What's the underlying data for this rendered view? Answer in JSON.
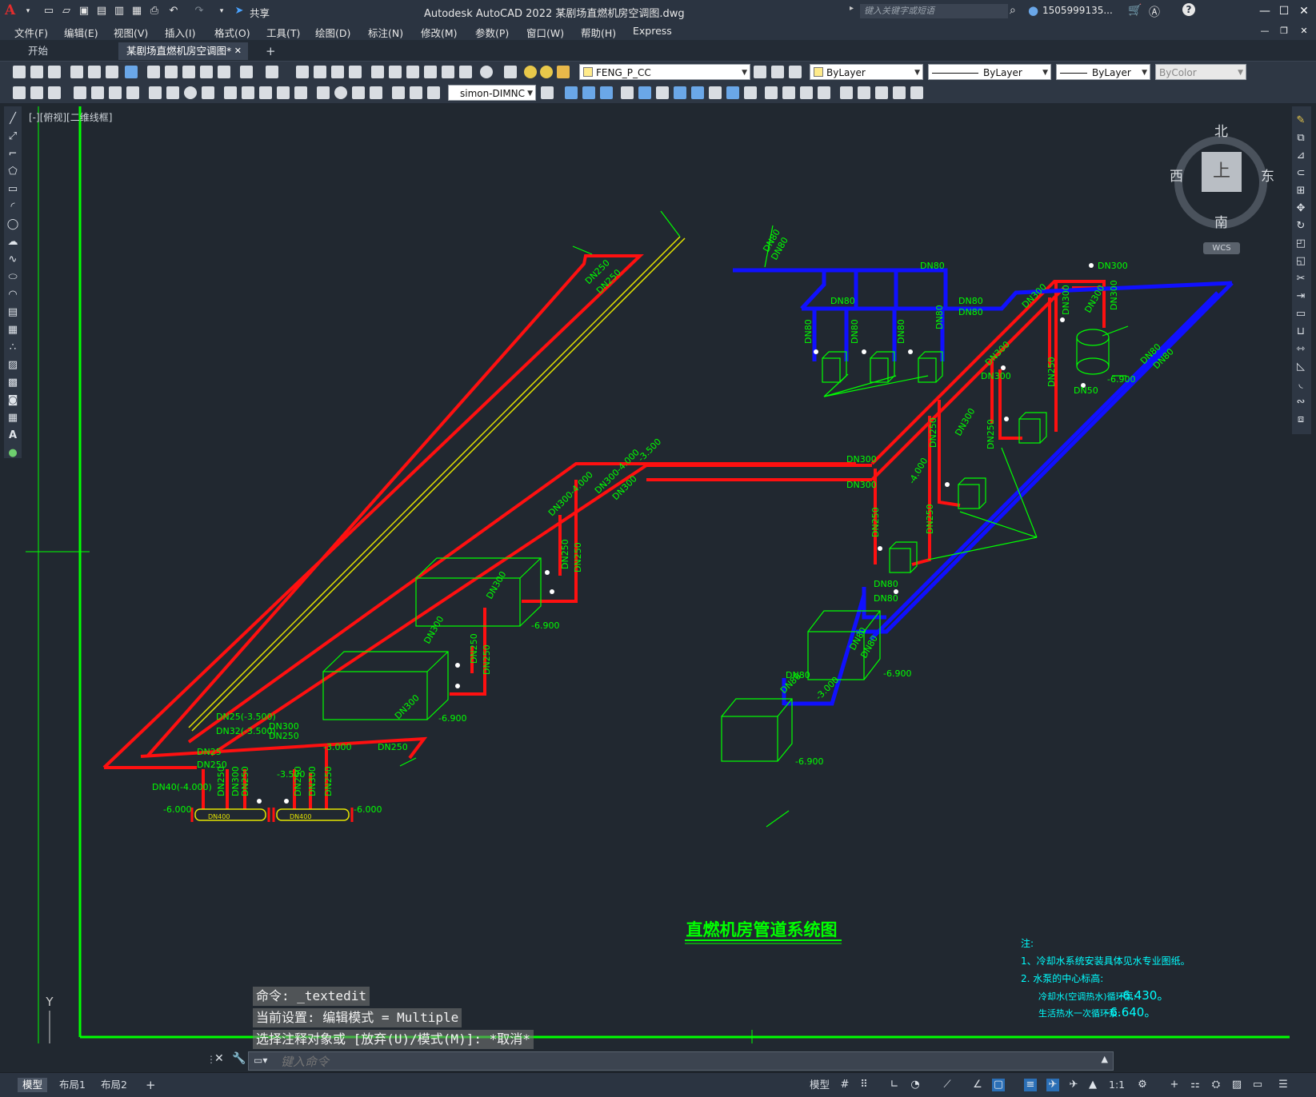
{
  "app": {
    "title": "Autodesk AutoCAD 2022    某剧场直燃机房空调图.dwg",
    "logo": "A",
    "share_label": "共享",
    "search_placeholder": "键入关键字或短语",
    "user": "1505999135...",
    "help": "?"
  },
  "menu": [
    "文件(F)",
    "编辑(E)",
    "视图(V)",
    "插入(I)",
    "格式(O)",
    "工具(T)",
    "绘图(D)",
    "标注(N)",
    "修改(M)",
    "参数(P)",
    "窗口(W)",
    "帮助(H)",
    "Express"
  ],
  "tabs": {
    "start": "开始",
    "drawing": "某剧场直燃机房空调图*",
    "add": "+"
  },
  "toolbar": {
    "layer": "FENG_P_CC",
    "color": "ByLayer",
    "linetype": "ByLayer",
    "lineweight": "ByLayer",
    "plotstyle": "ByColor",
    "dimstyle": "simon-DIMNC"
  },
  "viewport": {
    "label": "[-][俯视][二维线框]",
    "viewcube": {
      "top": "上",
      "north": "北",
      "south": "南",
      "east": "东",
      "west": "西",
      "wcs": "WCS"
    }
  },
  "drawing": {
    "title": "直燃机房管道系统图",
    "notes": {
      "heading": "注:",
      "n1": "1、冷却水系统安装具体见水专业图纸。",
      "n2": "2. 水泵的中心标高:",
      "n3_label": "冷却水(空调热水)循环泵:",
      "n3_value": "-6.430。",
      "n4_label": "生活热水一次循环泵:",
      "n4_value": "-6.640。"
    },
    "labels": {
      "dn250": "DN250",
      "dn300": "DN300",
      "dn80": "DN80",
      "dn50": "DN50",
      "dn25": "DN25(-3.500)",
      "dn32": "DN32(-3.500)",
      "dn25b": "DN25",
      "dn40": "DN40(-4.000)",
      "dn400": "DN400",
      "e3500": "-3.500",
      "e4000": "-4.000",
      "e3000": "-3.000",
      "e6900": "-6.900",
      "e6000": "-6.000",
      "dn300e4000": "DN300-4.000",
      "dn300e4000b": "DN300-4.000",
      "ucs_y": "Y"
    }
  },
  "command": {
    "h1": "命令: _textedit",
    "h2": "当前设置: 编辑模式 = Multiple",
    "h3": "选择注释对象或 [放弃(U)/模式(M)]: *取消*",
    "placeholder": "键入命令"
  },
  "status": {
    "model": "模型",
    "layout1": "布局1",
    "layout2": "布局2",
    "add": "+",
    "model_space": "模型",
    "scale": "1:1"
  },
  "colors": {
    "red_pipe": "#ff1010",
    "blue_pipe": "#1010ff",
    "green": "#00ff00",
    "yellow": "#e6e600",
    "background": "#212830"
  }
}
